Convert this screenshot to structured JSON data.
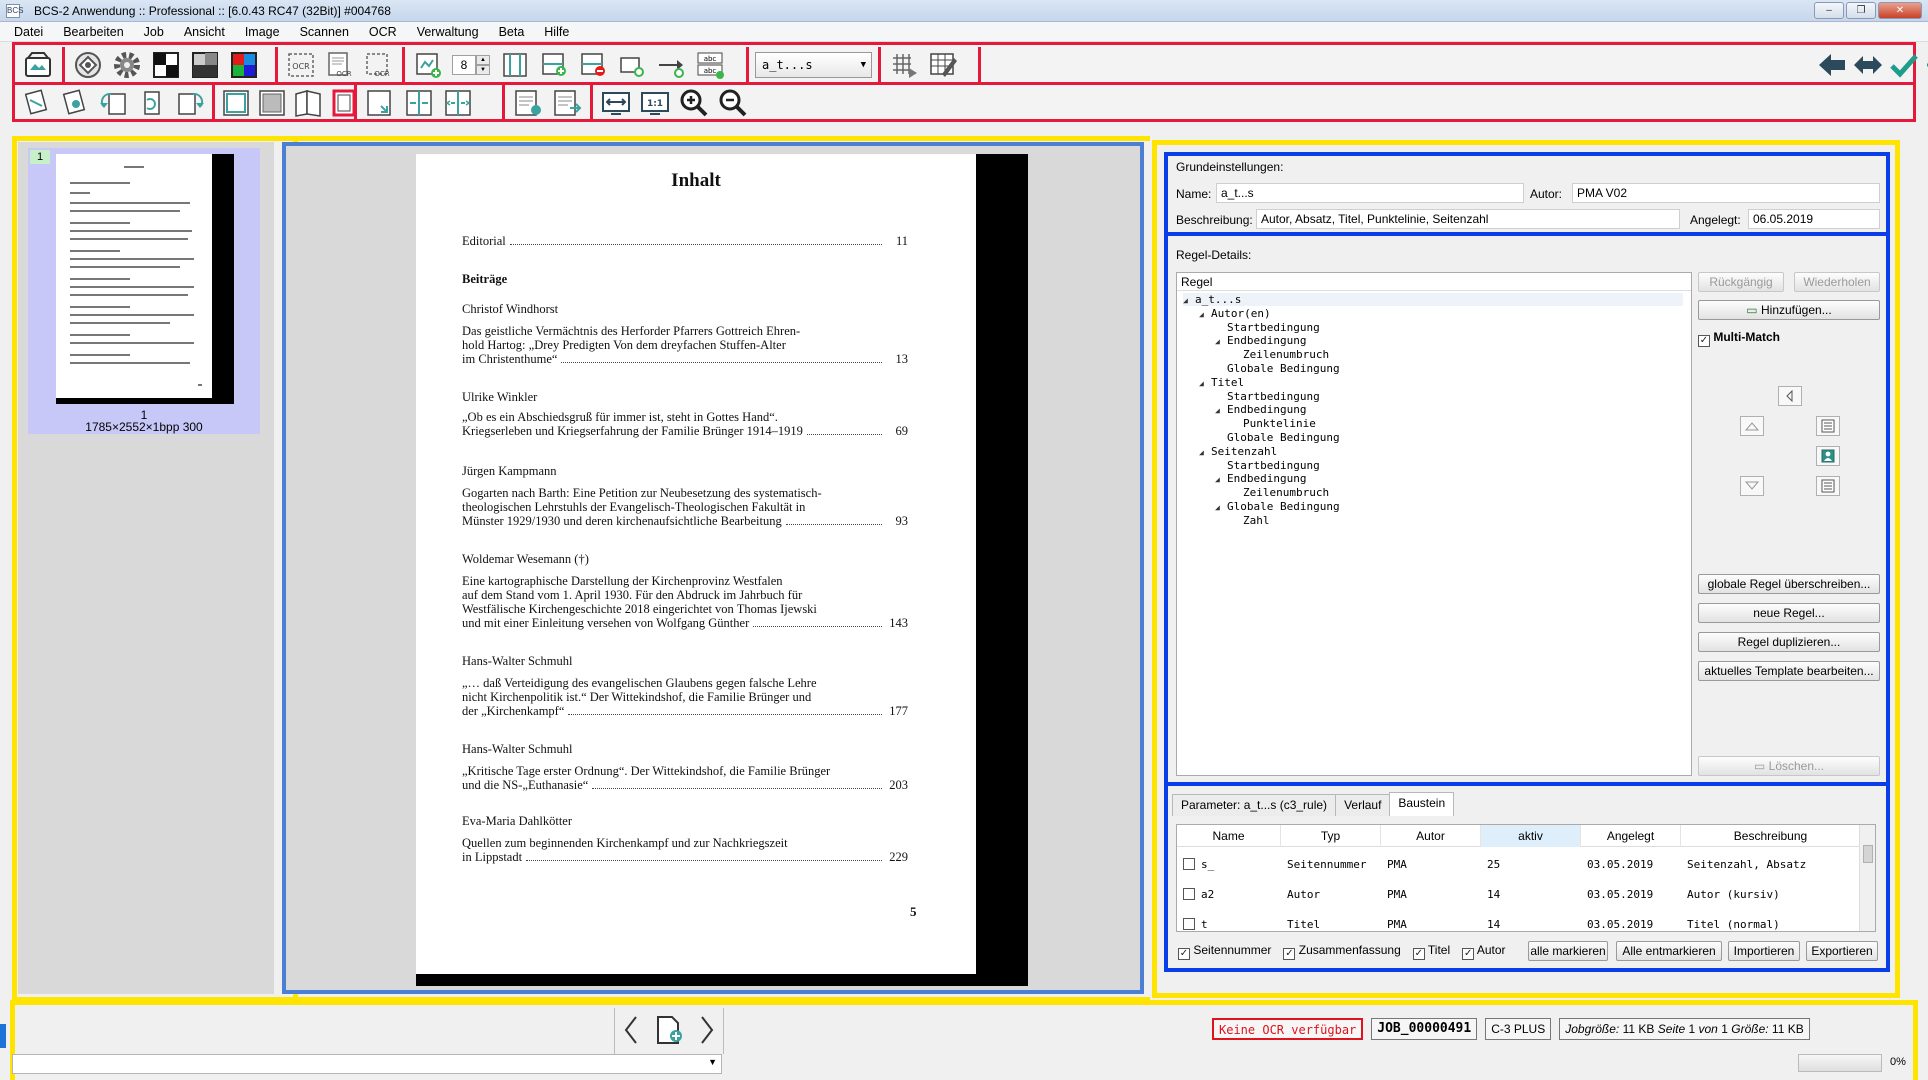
{
  "window": {
    "title": "BCS-2 Anwendung :: Professional :: [6.0.43 RC47 (32Bit)]  #004768",
    "icon_label": "BCS"
  },
  "menu": [
    "Datei",
    "Bearbeiten",
    "Job",
    "Ansicht",
    "Image",
    "Scannen",
    "OCR",
    "Verwaltung",
    "Beta",
    "Hilfe"
  ],
  "toolbar": {
    "spin_value": "8",
    "rule_combo": "a_t...s"
  },
  "thumbnail": {
    "index": "1",
    "page_number": "1",
    "info": "1785×2552×1bpp 300"
  },
  "document": {
    "heading": "Inhalt",
    "editorial": {
      "text": "Editorial",
      "page": "11"
    },
    "section": "Beiträge",
    "entries": [
      {
        "author": "Christof Windhorst",
        "lines": [
          "Das geistliche Vermächtnis des Herforder Pfarrers Gottreich Ehren-",
          "hold Hartog: „Drey Predigten Von dem dreyfachen Stuffen-Alter",
          "im Christenthume“"
        ],
        "page": "13"
      },
      {
        "author": "Ulrike Winkler",
        "lines": [
          "„Ob es ein Abschiedsgruß für immer ist, steht in Gottes Hand“.",
          "Kriegserleben und Kriegserfahrung der Familie Brünger 1914–1919"
        ],
        "page": "69"
      },
      {
        "author": "Jürgen Kampmann",
        "lines": [
          "Gogarten nach Barth: Eine Petition zur Neubesetzung des systematisch-",
          "theologischen Lehrstuhls der Evangelisch-Theologischen Fakultät in",
          "Münster 1929/1930 und deren kirchenaufsichtliche Bearbeitung"
        ],
        "page": "93"
      },
      {
        "author": "Woldemar Wesemann (†)",
        "lines": [
          "Eine kartographische Darstellung der Kirchenprovinz Westfalen",
          "auf dem Stand vom 1. April 1930. Für den Abdruck im Jahrbuch für",
          "Westfälische Kirchengeschichte 2018 eingerichtet von Thomas Ijewski",
          "und mit einer Einleitung versehen von Wolfgang Günther"
        ],
        "page": "143"
      },
      {
        "author": "Hans-Walter Schmuhl",
        "lines": [
          "„… daß Verteidigung des evangelischen Glaubens gegen falsche Lehre",
          "nicht Kirchenpolitik ist.“ Der Wittekindshof, die Familie Brünger und",
          "der „Kirchenkampf“"
        ],
        "page": "177"
      },
      {
        "author": "Hans-Walter Schmuhl",
        "lines": [
          "„Kritische Tage erster Ordnung“. Der Wittekindshof, die Familie Brünger",
          "und die NS-„Euthanasie“"
        ],
        "page": "203"
      },
      {
        "author": "Eva-Maria Dahlkötter",
        "lines": [
          "Quellen zum beginnenden Kirchenkampf und zur Nachkriegszeit",
          "in Lippstadt"
        ],
        "page": "229"
      }
    ],
    "page_number": "5"
  },
  "basic": {
    "section_label": "Grundeinstellungen:",
    "name_label": "Name:",
    "name_value": "a_t...s",
    "author_label": "Autor:",
    "author_value": "PMA V02",
    "desc_label": "Beschreibung:",
    "desc_value": "Autor, Absatz, Titel, Punktelinie, Seitenzahl",
    "created_label": "Angelegt:",
    "created_value": "06.05.2019"
  },
  "rule": {
    "section_label": "Regel-Details:",
    "tree_header": "Regel",
    "tree": [
      {
        "level": 0,
        "label": "a_t...s",
        "toggle": "◢"
      },
      {
        "level": 1,
        "label": "Autor(en)",
        "toggle": "◢"
      },
      {
        "level": 2,
        "label": "Startbedingung",
        "toggle": ""
      },
      {
        "level": 2,
        "label": "Endbedingung",
        "toggle": "◢"
      },
      {
        "level": 3,
        "label": "Zeilenumbruch",
        "toggle": ""
      },
      {
        "level": 2,
        "label": "Globale Bedingung",
        "toggle": ""
      },
      {
        "level": 1,
        "label": "Titel",
        "toggle": "◢"
      },
      {
        "level": 2,
        "label": "Startbedingung",
        "toggle": ""
      },
      {
        "level": 2,
        "label": "Endbedingung",
        "toggle": "◢"
      },
      {
        "level": 3,
        "label": "Punktelinie",
        "toggle": ""
      },
      {
        "level": 2,
        "label": "Globale Bedingung",
        "toggle": ""
      },
      {
        "level": 1,
        "label": "Seitenzahl",
        "toggle": "◢"
      },
      {
        "level": 2,
        "label": "Startbedingung",
        "toggle": ""
      },
      {
        "level": 2,
        "label": "Endbedingung",
        "toggle": "◢"
      },
      {
        "level": 3,
        "label": "Zeilenumbruch",
        "toggle": ""
      },
      {
        "level": 2,
        "label": "Globale Bedingung",
        "toggle": "◢"
      },
      {
        "level": 3,
        "label": "Zahl",
        "toggle": ""
      }
    ],
    "undo": "Rückgängig",
    "redo": "Wiederholen",
    "add": "Hinzufügen...",
    "multimatch": "Multi-Match",
    "override_global": "globale Regel überschreiben...",
    "new_rule": "neue Regel...",
    "duplicate": "Regel duplizieren...",
    "edit_template": "aktuelles Template bearbeiten...",
    "delete": "Löschen..."
  },
  "tabs": [
    "Parameter: a_t...s (c3_rule)",
    "Verlauf",
    "Baustein"
  ],
  "table": {
    "columns": [
      "Name",
      "Typ",
      "Autor",
      "aktiv",
      "Angelegt",
      "Beschreibung"
    ],
    "rows": [
      [
        "s_",
        "Seitennummer",
        "PMA",
        "25",
        "03.05.2019",
        "Seitenzahl, Absatz"
      ],
      [
        "a2",
        "Autor",
        "PMA",
        "14",
        "03.05.2019",
        "Autor (kursiv)"
      ],
      [
        "t",
        "Titel",
        "PMA",
        "14",
        "03.05.2019",
        "Titel (normal)"
      ]
    ]
  },
  "filters": {
    "seitennummer": "Seitennummer",
    "zusammenfassung": "Zusammenfassung",
    "titel": "Titel",
    "autor": "Autor",
    "mark_all": "alle markieren",
    "unmark_all": "Alle entmarkieren",
    "import": "Importieren",
    "export": "Exportieren"
  },
  "status": {
    "ocr": "Keine OCR verfügbar",
    "job": "JOB_00000491",
    "product": "C-3 PLUS",
    "size_label": "Jobgröße:",
    "size_value": "11 KB",
    "page_label": "Seite",
    "page_value": "1",
    "of_label": "von",
    "of_value": "1",
    "fsize_label": "Größe:",
    "fsize_value": "11 KB",
    "zoom": "0%"
  },
  "colors": {
    "toolbar_frame": "#e5193c",
    "panel_frame": "#ffe400",
    "detail_frame": "#0a3ee8",
    "viewer_frame": "#4a7fd4"
  }
}
